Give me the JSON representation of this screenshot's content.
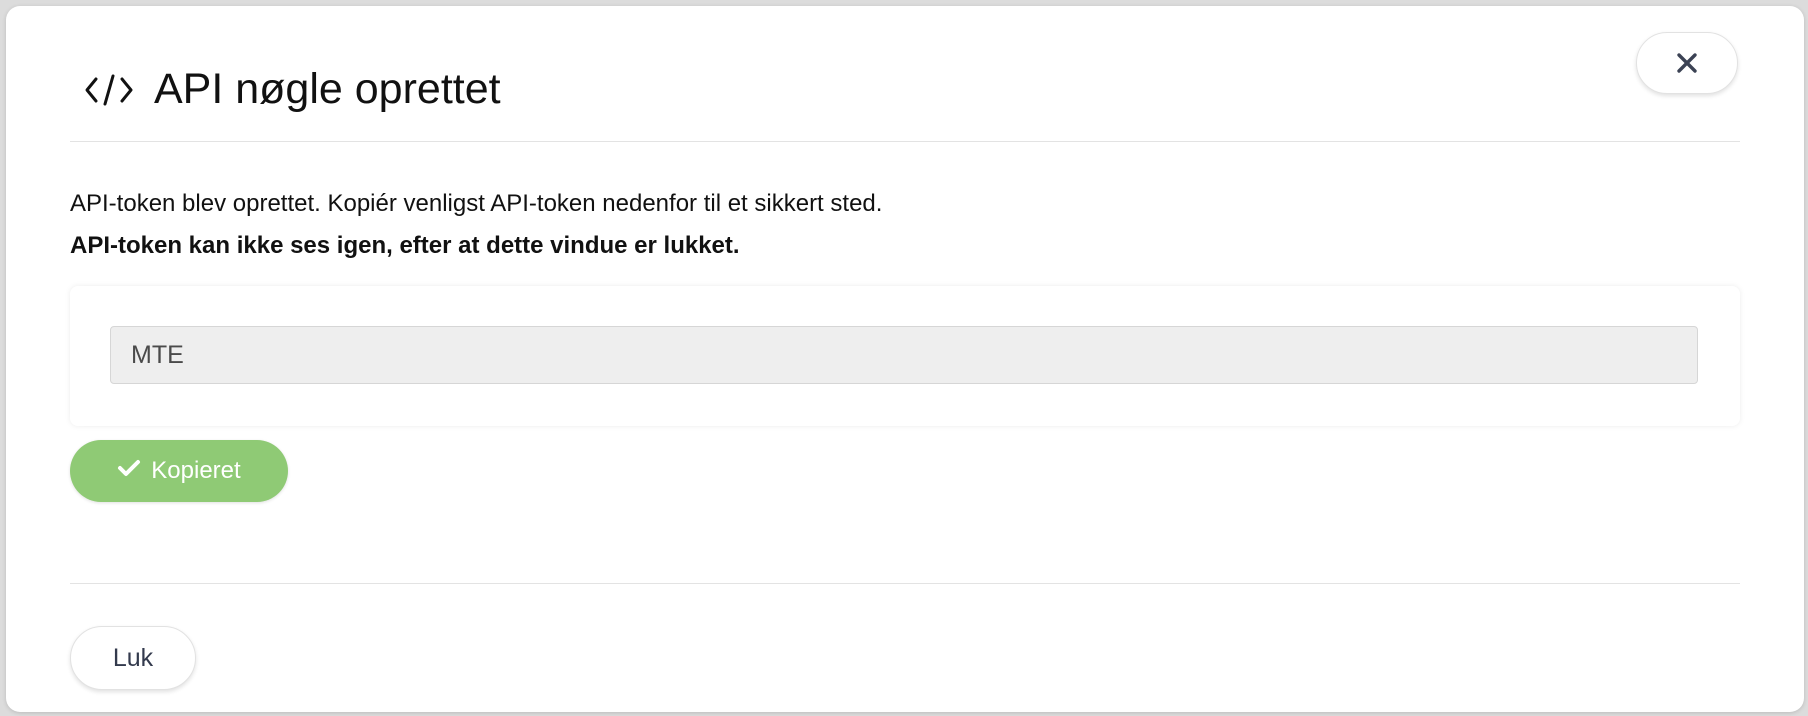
{
  "modal": {
    "title": "API nøgle oprettet",
    "title_icon": "code-icon",
    "close_icon": "close-icon"
  },
  "message": {
    "line1": "API-token blev oprettet. Kopiér venligst API-token nedenfor til et sikkert sted.",
    "line2": "API-token kan ikke ses igen, efter at dette vindue er lukket."
  },
  "token": {
    "value": "MTE"
  },
  "copy_button": {
    "label": "Kopieret",
    "icon": "check-icon",
    "color": "#8fca75"
  },
  "footer": {
    "close_label": "Luk"
  }
}
